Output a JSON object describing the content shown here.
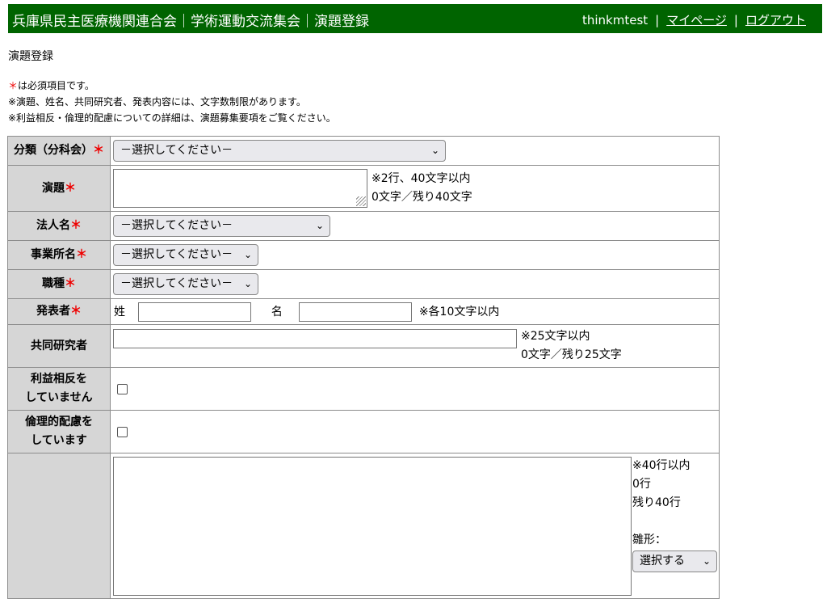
{
  "header": {
    "title": "兵庫県民主医療機関連合会｜学術運動交流集会｜演題登録",
    "user": "thinkmtest",
    "separator": "|",
    "mypage_link": "マイページ",
    "logout_link": "ログアウト"
  },
  "page_title": "演題登録",
  "notes": {
    "required_mark": "＊",
    "required_text": "は必須項目です。",
    "line2": "※演題、姓名、共同研究者、発表内容には、文字数制限があります。",
    "line3": "※利益相反・倫理的配慮についての詳細は、演題募集要項をご覧ください。"
  },
  "form": {
    "required_star": "＊",
    "category": {
      "label": "分類（分科会）",
      "value": "－選択してください－"
    },
    "title": {
      "label": "演題",
      "hint1": "※2行、40文字以内",
      "hint2": "0文字／残り40文字"
    },
    "corporation": {
      "label": "法人名",
      "value": "－選択してください－"
    },
    "office": {
      "label": "事業所名",
      "value": "－選択してください－"
    },
    "occupation": {
      "label": "職種",
      "value": "－選択してください－"
    },
    "presenter": {
      "label": "発表者",
      "sei": "姓",
      "mei": "名",
      "hint": "※各10文字以内"
    },
    "coresearcher": {
      "label": "共同研究者",
      "hint1": "※25文字以内",
      "hint2": "0文字／残り25文字"
    },
    "conflict": {
      "label_line1": "利益相反を",
      "label_line2": "していません"
    },
    "ethics": {
      "label_line1": "倫理的配慮を",
      "label_line2": "しています"
    },
    "content": {
      "hint1": "※40行以内",
      "hint2": "0行",
      "hint3": "残り40行",
      "template_label": "雛形：",
      "template_value": "選択する"
    }
  },
  "icons": {
    "dropdown": "chevron-down-icon",
    "resize": "resize-grip-icon"
  },
  "colors": {
    "header_bg": "#006400",
    "label_bg": "#d6d6d6",
    "required": "#e00000"
  }
}
